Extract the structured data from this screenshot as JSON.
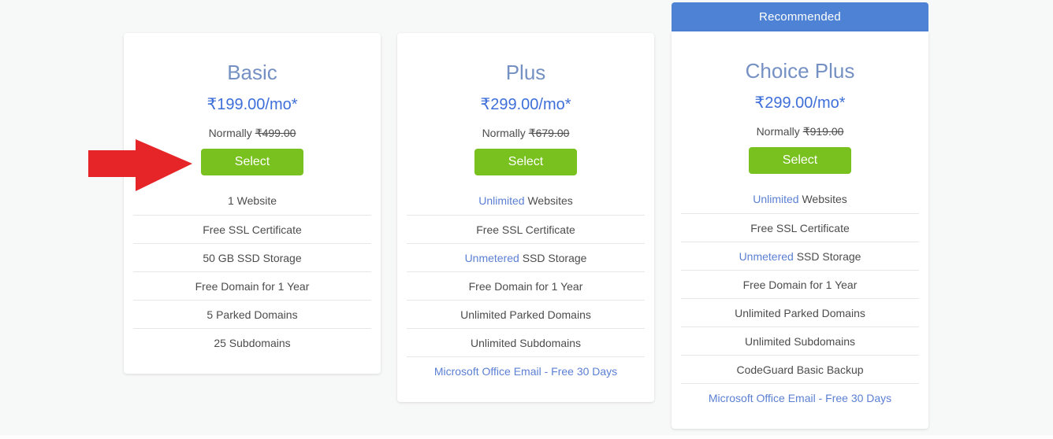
{
  "page": {
    "background": "#f7f8f8"
  },
  "recommended_banner": {
    "label": "Recommended",
    "background": "#4e82d4",
    "text_color": "#ffffff"
  },
  "annotation_arrow": {
    "description": "red arrow pointing at Basic plan Select button",
    "color": "#e62529"
  },
  "colors": {
    "plan_title": "#7590c2",
    "price": "#3e6fd9",
    "body_text": "#4c4c4c",
    "highlight_text": "#5b80d3",
    "select_button": "#78c11e",
    "divider": "#e7e7e7",
    "card_background": "#ffffff"
  },
  "plans": [
    {
      "id": "basic",
      "name": "Basic",
      "price": "₹199.00/mo*",
      "normally_label": "Normally",
      "normally_price": "₹499.00",
      "select_label": "Select",
      "recommended": false,
      "features": [
        {
          "parts": [
            {
              "text": "1 Website",
              "highlight": false
            }
          ]
        },
        {
          "parts": [
            {
              "text": "Free SSL Certificate",
              "highlight": false
            }
          ]
        },
        {
          "parts": [
            {
              "text": "50 GB SSD Storage",
              "highlight": false
            }
          ]
        },
        {
          "parts": [
            {
              "text": "Free Domain for 1 Year",
              "highlight": false
            }
          ]
        },
        {
          "parts": [
            {
              "text": "5 Parked Domains",
              "highlight": false
            }
          ]
        },
        {
          "parts": [
            {
              "text": "25 Subdomains",
              "highlight": false
            }
          ]
        }
      ]
    },
    {
      "id": "plus",
      "name": "Plus",
      "price": "₹299.00/mo*",
      "normally_label": "Normally",
      "normally_price": "₹679.00",
      "select_label": "Select",
      "recommended": false,
      "features": [
        {
          "parts": [
            {
              "text": "Unlimited",
              "highlight": true
            },
            {
              "text": " Websites",
              "highlight": false
            }
          ]
        },
        {
          "parts": [
            {
              "text": "Free SSL Certificate",
              "highlight": false
            }
          ]
        },
        {
          "parts": [
            {
              "text": "Unmetered",
              "highlight": true
            },
            {
              "text": " SSD Storage",
              "highlight": false
            }
          ]
        },
        {
          "parts": [
            {
              "text": "Free Domain for 1 Year",
              "highlight": false
            }
          ]
        },
        {
          "parts": [
            {
              "text": "Unlimited Parked Domains",
              "highlight": false
            }
          ]
        },
        {
          "parts": [
            {
              "text": "Unlimited Subdomains",
              "highlight": false
            }
          ]
        },
        {
          "parts": [
            {
              "text": "Microsoft Office Email - Free 30 Days",
              "highlight": true
            }
          ]
        }
      ]
    },
    {
      "id": "choice-plus",
      "name": "Choice Plus",
      "price": "₹299.00/mo*",
      "normally_label": "Normally",
      "normally_price": "₹919.00",
      "select_label": "Select",
      "recommended": true,
      "features": [
        {
          "parts": [
            {
              "text": "Unlimited",
              "highlight": true
            },
            {
              "text": " Websites",
              "highlight": false
            }
          ]
        },
        {
          "parts": [
            {
              "text": "Free SSL Certificate",
              "highlight": false
            }
          ]
        },
        {
          "parts": [
            {
              "text": "Unmetered",
              "highlight": true
            },
            {
              "text": " SSD Storage",
              "highlight": false
            }
          ]
        },
        {
          "parts": [
            {
              "text": "Free Domain for 1 Year",
              "highlight": false
            }
          ]
        },
        {
          "parts": [
            {
              "text": "Unlimited Parked Domains",
              "highlight": false
            }
          ]
        },
        {
          "parts": [
            {
              "text": "Unlimited Subdomains",
              "highlight": false
            }
          ]
        },
        {
          "parts": [
            {
              "text": "CodeGuard Basic Backup",
              "highlight": false
            }
          ]
        },
        {
          "parts": [
            {
              "text": "Microsoft Office Email - Free 30 Days",
              "highlight": true
            }
          ]
        }
      ]
    }
  ]
}
